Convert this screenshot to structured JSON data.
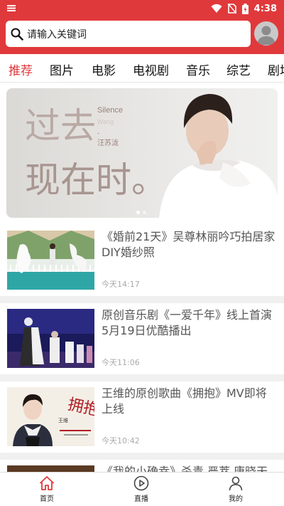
{
  "status_bar": {
    "time": "4:38"
  },
  "search": {
    "placeholder": "请输入关键词"
  },
  "tabs": [
    {
      "label": "推荐",
      "active": true
    },
    {
      "label": "图片",
      "active": false
    },
    {
      "label": "电影",
      "active": false
    },
    {
      "label": "电视剧",
      "active": false
    },
    {
      "label": "音乐",
      "active": false
    },
    {
      "label": "综艺",
      "active": false
    },
    {
      "label": "剧场",
      "active": false
    }
  ],
  "banner": {
    "big_text_line1": "过去",
    "big_text_line2": "现在时。",
    "song_en_1": "Silence",
    "song_en_2": "Wang",
    "artist": "汪苏泷",
    "dash": "-",
    "page_index": 1,
    "page_count": 2
  },
  "news": [
    {
      "title": "《婚前21天》吴尊林丽吟巧拍居家DIY婚纱照",
      "time": "今天14:17",
      "thumb": "wedding-beach-photo"
    },
    {
      "title": "原创音乐剧《一爱千年》线上首演 5月19日优酷播出",
      "time": "今天11:06",
      "thumb": "stage-performance-photo"
    },
    {
      "title": "王维的原创歌曲《拥抱》MV即将上线",
      "time": "今天10:42",
      "thumb": "mv-poster-photo",
      "thumb_poster_text": "拥抱",
      "thumb_name": "王维"
    },
    {
      "title": "《我的小确幸》杀青 严萃 唐晓天演",
      "time": "",
      "thumb": "drama-photo"
    }
  ],
  "bottom_nav": [
    {
      "label": "首页",
      "icon": "home-icon",
      "active": true
    },
    {
      "label": "直播",
      "icon": "play-circle-icon",
      "active": false
    },
    {
      "label": "我的",
      "icon": "user-icon",
      "active": false
    }
  ],
  "colors": {
    "brand": "#e0393b",
    "title_text": "#555555",
    "time_text": "#aaaaaa"
  }
}
